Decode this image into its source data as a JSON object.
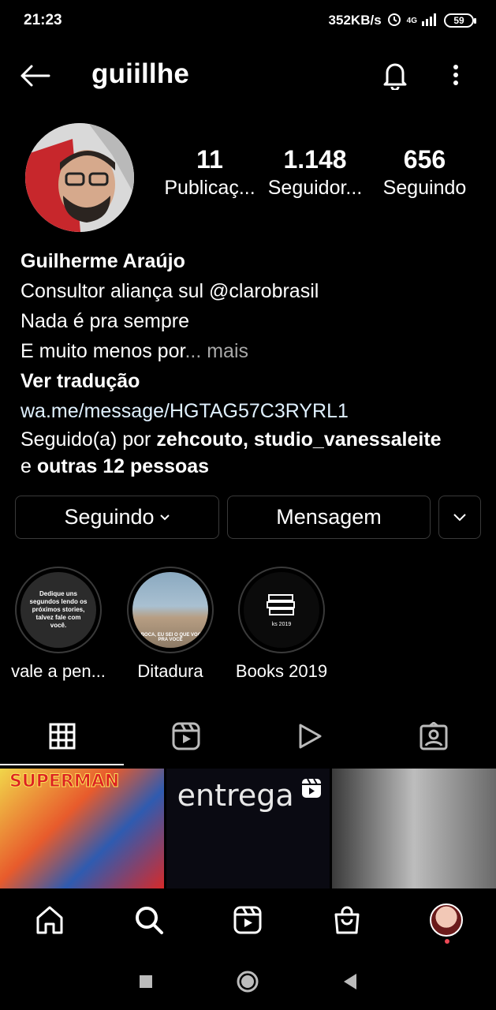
{
  "status_bar": {
    "time": "21:23",
    "speed": "352KB/s",
    "network": "4G",
    "battery": "59"
  },
  "header": {
    "username": "guiillhe"
  },
  "stats": [
    {
      "value": "11",
      "label": "Publicaç..."
    },
    {
      "value": "1.148",
      "label": "Seguidor..."
    },
    {
      "value": "656",
      "label": "Seguindo"
    }
  ],
  "bio": {
    "name": "Guilherme Araújo",
    "line1": "Consultor aliança sul @clarobrasil",
    "line2": "Nada é pra sempre",
    "line3": "E muito menos por",
    "more": "... mais",
    "translate": "Ver tradução",
    "link": "wa.me/message/HGTAG57C3RYRL1",
    "followed_prefix": "Seguido(a) por ",
    "followed_users": "zehcouto, studio_vanessaleite",
    "followed_and": "e ",
    "followed_others": "outras 12 pessoas"
  },
  "actions": {
    "following_label": "Seguindo",
    "message_label": "Mensagem"
  },
  "highlights": [
    {
      "label": "vale a pen...",
      "cover_text": "Dedique uns segundos lendo os próximos stories, talvez fale com você."
    },
    {
      "label": "Ditadura",
      "cover_text": "A BOCA, EU SEI O QUE VOCÊ PRA VOCÊ"
    },
    {
      "label": "Books 2019",
      "cover_text": "ks 2019"
    }
  ],
  "posts": [
    {
      "text": "SUPERMAN"
    },
    {
      "text": "entrega"
    },
    {
      "text": ""
    }
  ],
  "icons": {
    "back": "arrow-left-icon",
    "bell": "bell-icon",
    "more": "more-vertical-icon",
    "grid": "grid-icon",
    "reels": "reels-icon",
    "video": "play-icon",
    "tagged": "tagged-icon",
    "home": "home-icon",
    "search": "search-icon",
    "shop": "shop-icon"
  },
  "colors": {
    "background": "#000000",
    "text": "#ffffff",
    "muted": "#a8a8a8",
    "link": "#e0f1ff",
    "border": "#3a3a3a",
    "notification_dot": "#ed4956"
  }
}
